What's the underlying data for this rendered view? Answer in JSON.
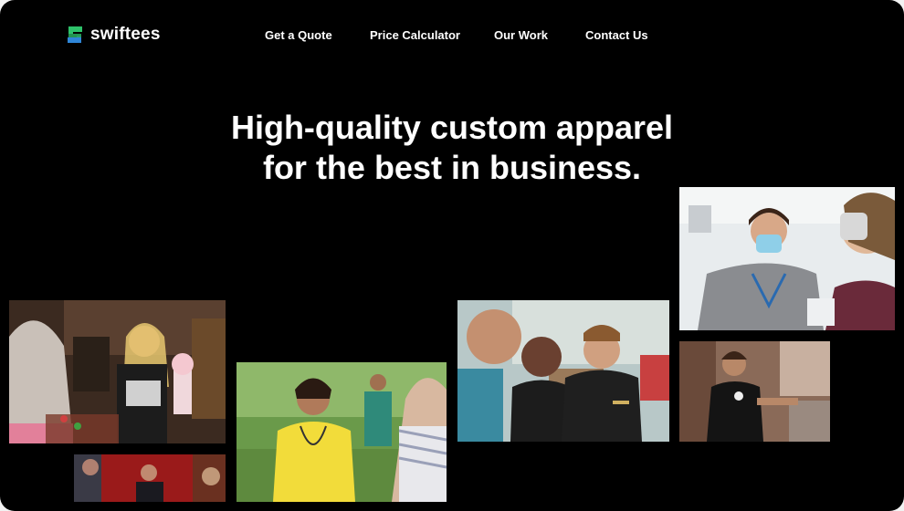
{
  "brand": {
    "name": "swiftees",
    "colors": {
      "green": "#2ec26a",
      "blue": "#2f86d8",
      "text": "#ffffff",
      "background": "#000000"
    }
  },
  "nav": {
    "items": [
      {
        "label": "Get a Quote"
      },
      {
        "label": "Price Calculator"
      },
      {
        "label": "Our Work"
      },
      {
        "label": "Contact Us"
      }
    ]
  },
  "hero": {
    "headline_line1": "High-quality custom apparel",
    "headline_line2": "for the best in business."
  },
  "photos": [
    {
      "subject": "waitress-milkshake-photo"
    },
    {
      "subject": "nurse-outdoors-photo"
    },
    {
      "subject": "staff-polo-shirts-photo"
    },
    {
      "subject": "masked-clinician-photo"
    },
    {
      "subject": "warehouse-worker-photo"
    },
    {
      "subject": "red-stage-photo"
    }
  ]
}
